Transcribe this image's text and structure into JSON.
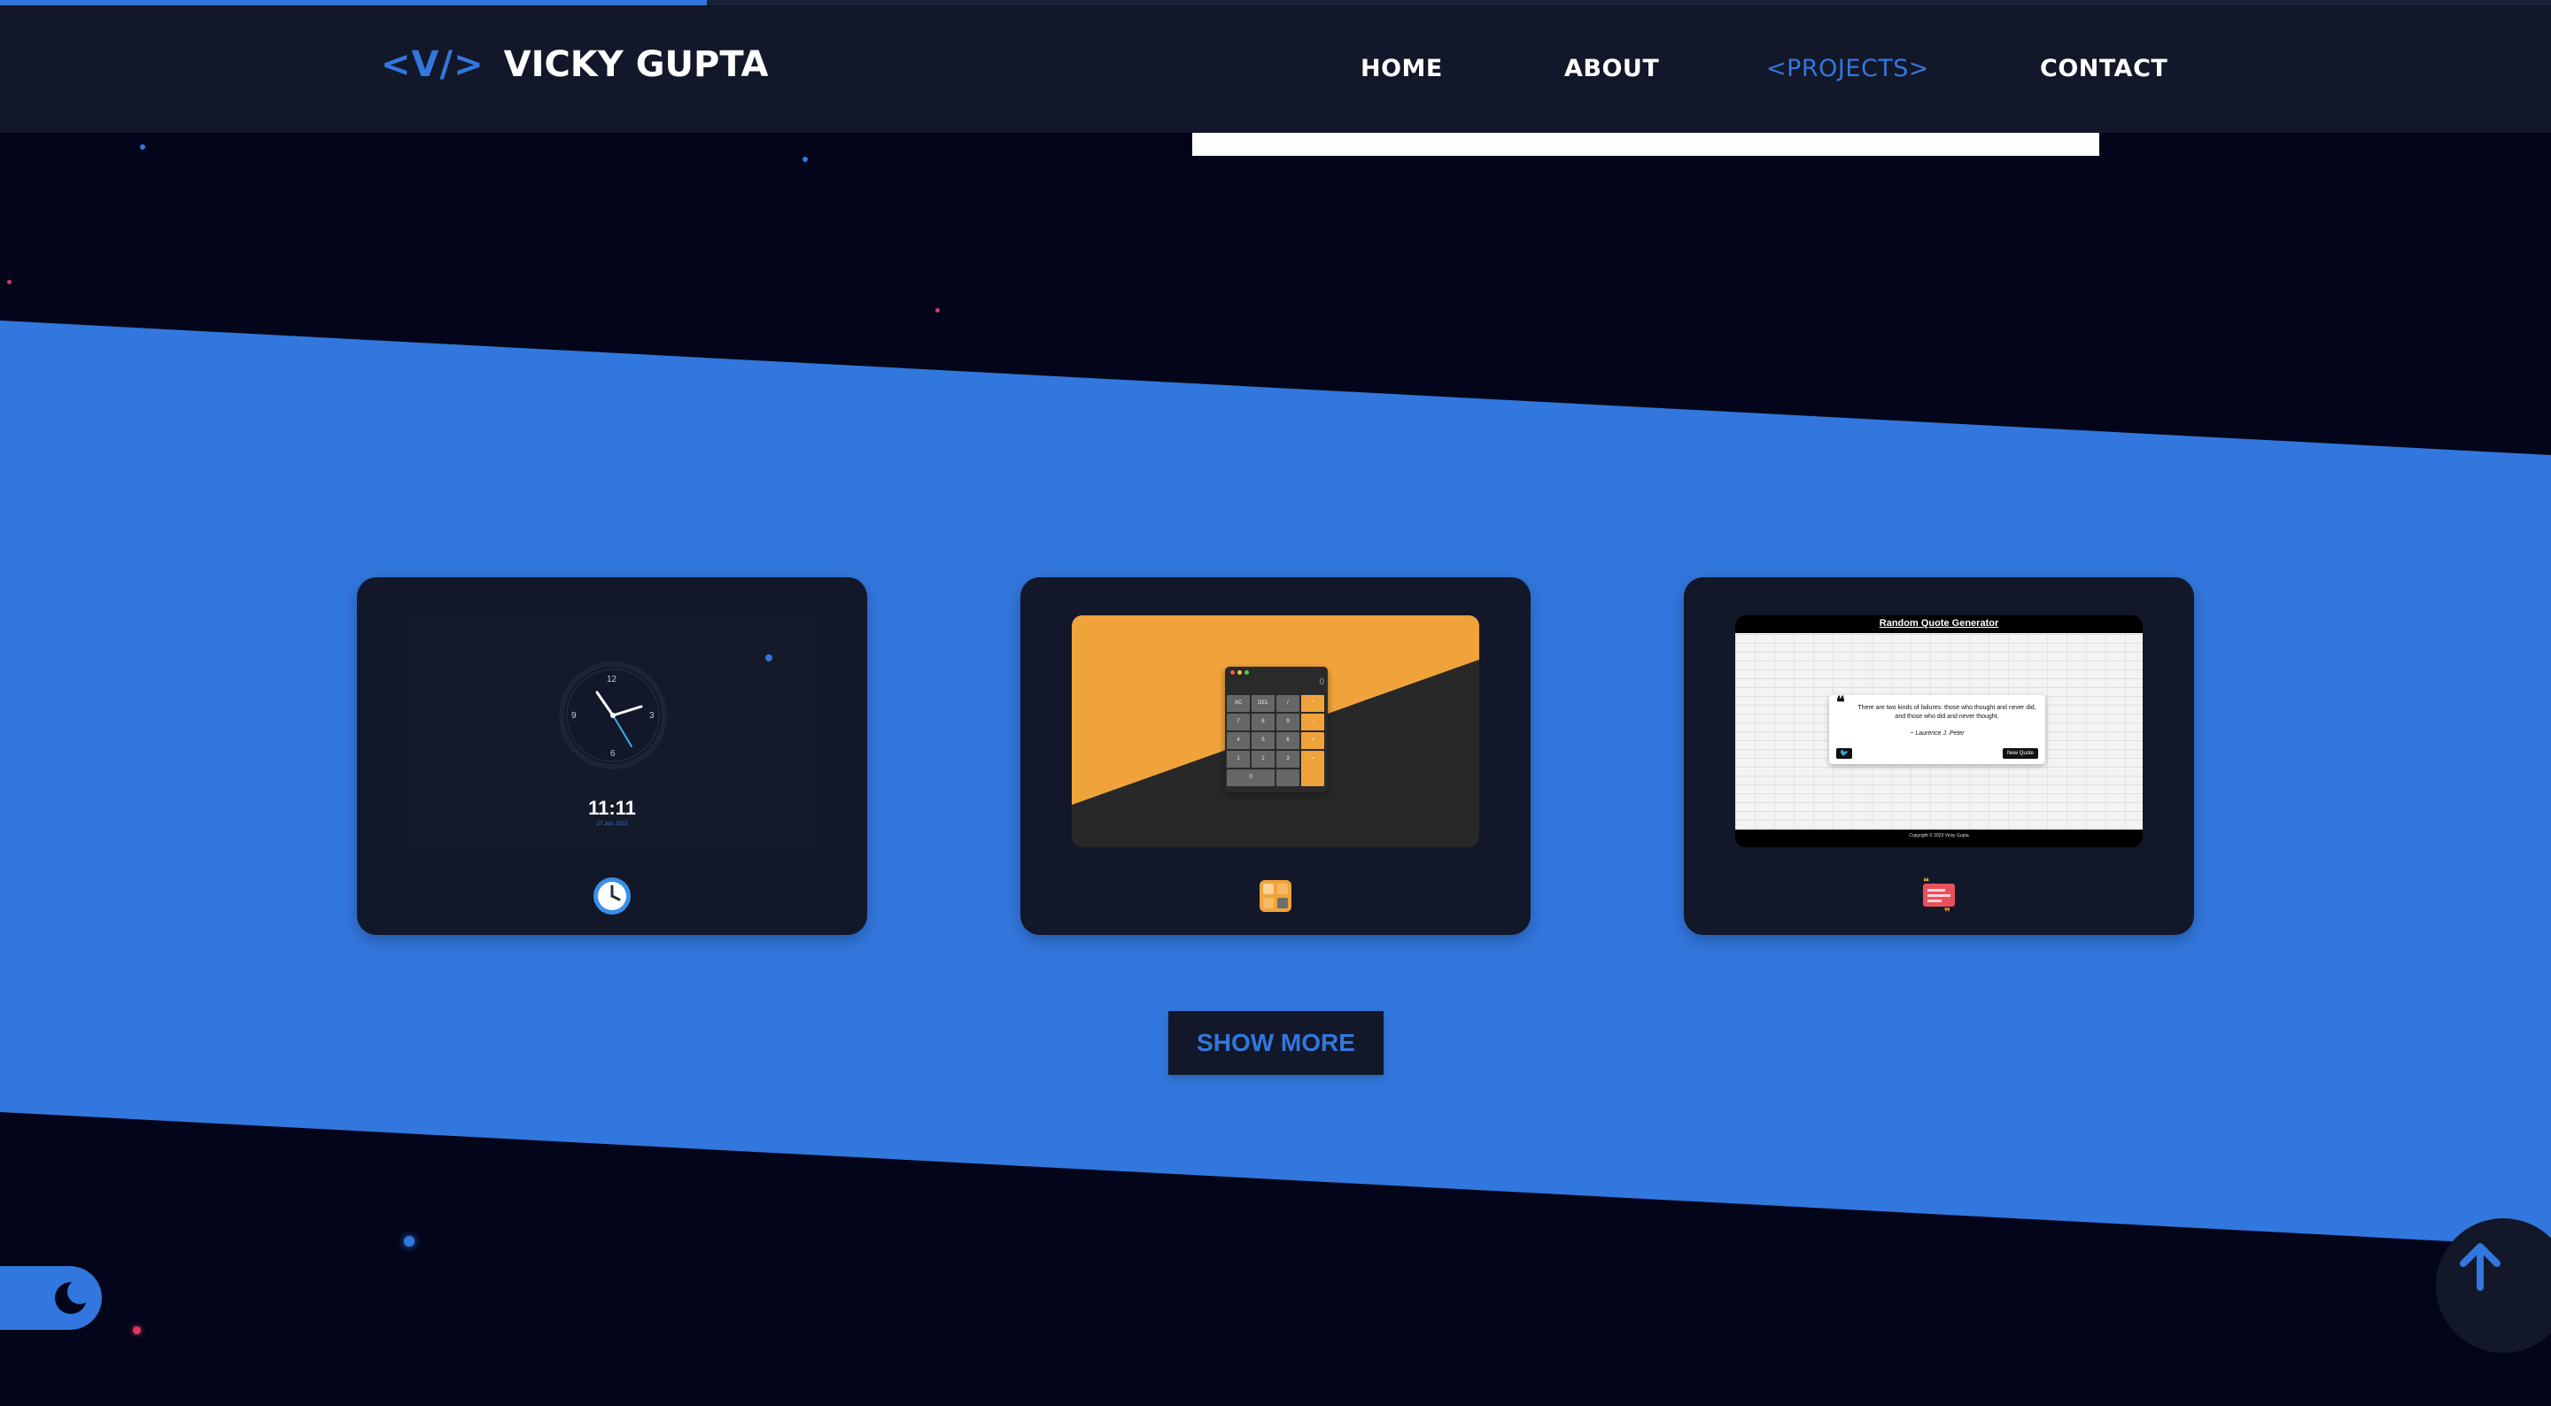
{
  "scroll_progress": 0.277,
  "header": {
    "logo_mark": "<V/>",
    "logo_name": "VICKY GUPTA",
    "nav": [
      {
        "label": "HOME",
        "active": false
      },
      {
        "label": "ABOUT",
        "active": false
      },
      {
        "label": "<PROJECTS>",
        "active": true
      },
      {
        "label": "CONTACT",
        "active": false
      }
    ]
  },
  "colors": {
    "accent": "#3277dd",
    "page_background": "#03061a",
    "navbar": "#121729",
    "card": "#121729",
    "calculator_orange": "#f1a33b"
  },
  "projects": [
    {
      "name": "clock",
      "icon": "clock-icon",
      "preview": {
        "hour_labels": [
          "12",
          "3",
          "6",
          "9"
        ],
        "digital_time": "11:11",
        "date": "27 Jun, 2023"
      }
    },
    {
      "name": "calculator",
      "icon": "calculator-icon",
      "preview": {
        "display": "0",
        "keys": [
          [
            "AC",
            "DEL",
            "/",
            "*"
          ],
          [
            "7",
            "8",
            "9",
            "-"
          ],
          [
            "4",
            "5",
            "6",
            "+"
          ],
          [
            "1",
            "2",
            "3",
            "="
          ],
          [
            "0",
            "."
          ]
        ]
      }
    },
    {
      "name": "quote-generator",
      "icon": "quote-icon",
      "preview": {
        "title": "Random Quote Generator",
        "quote": "There are two kinds of failures: those who thought and never did, and those who did and never thought.",
        "author": "~ Laurence J. Peter",
        "new_quote_label": "New Quote",
        "footer": "Copyright © 2023 Vicky Gupta"
      }
    }
  ],
  "show_more_label": "SHOW MORE",
  "theme_toggle_icon": "moon-icon",
  "scroll_top_icon": "arrow-up-icon"
}
